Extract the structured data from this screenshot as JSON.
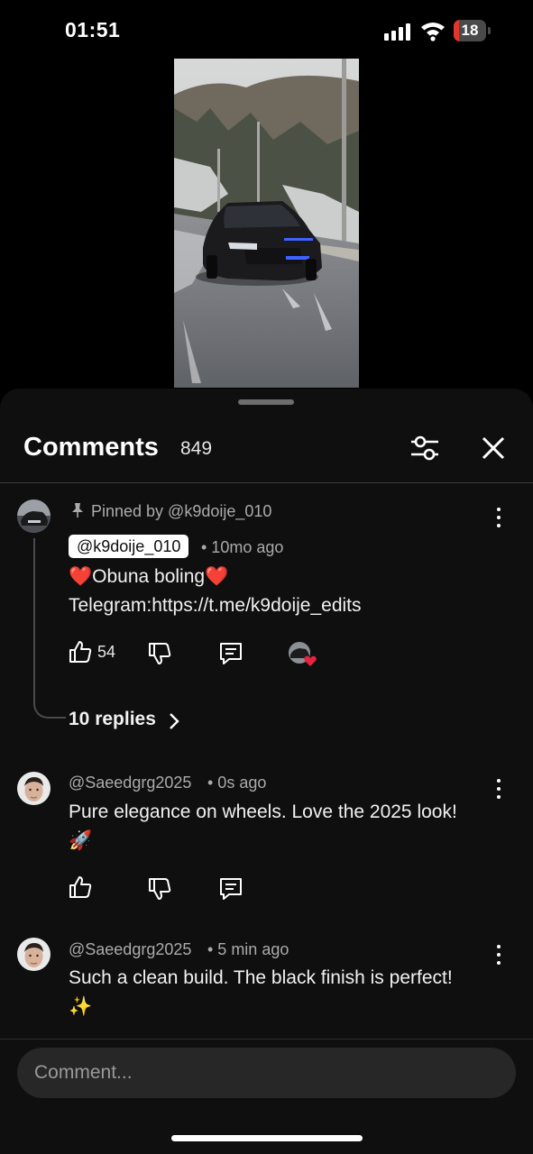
{
  "status_bar": {
    "time": "01:51",
    "battery": "18",
    "battery_level": 0.18
  },
  "comments_panel": {
    "title": "Comments",
    "count": "849",
    "filter_icon": "sliders-icon",
    "close_icon": "close-icon",
    "comments": [
      {
        "pinned_label": "Pinned by @k9doije_010",
        "author": "@k9doije_010",
        "time": "• 10mo ago",
        "text_line1": "❤️Obuna boling❤️",
        "text_line2": "Telegram:https://t.me/k9doije_edits",
        "likes": "54",
        "replies_label": "10 replies"
      },
      {
        "author": "@Saeedgrg2025",
        "time": "• 0s ago",
        "text_line1": "Pure elegance on wheels. Love the 2025 look!",
        "text_line2": "🚀"
      },
      {
        "author": "@Saeedgrg2025",
        "time": "• 5 min ago",
        "text_line1": "Such a clean build. The black finish is perfect!",
        "text_line2": "✨"
      }
    ]
  },
  "composer": {
    "placeholder": "Comment..."
  },
  "colors": {
    "sheet_bg": "#0f0f0f",
    "heart_red": "#e8233f",
    "battery_red": "#e5342d"
  }
}
